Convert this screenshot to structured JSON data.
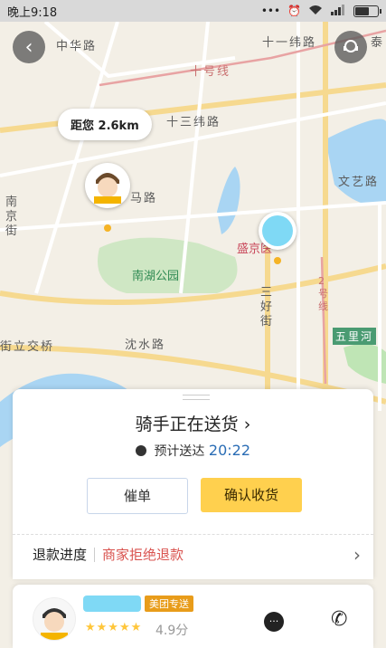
{
  "status_bar": {
    "time": "晚上9:18",
    "icons": [
      "dots",
      "alarm-icon",
      "wifi-icon",
      "signal-icon",
      "battery-icon"
    ]
  },
  "map": {
    "roads": [
      "中华路",
      "十一纬路",
      "十号线",
      "十三纬路",
      "马路",
      "南京街",
      "文艺路",
      "沈水路",
      "街立交桥",
      "三好街",
      "五里河",
      "2号线",
      "泰"
    ],
    "poi_park": "南湖公园",
    "poi_station": "盛京医",
    "distance_bubble": "距您 2.6km"
  },
  "card": {
    "title": "骑手正在送货 ",
    "title_chevron": "›",
    "eta_label": "预计送达",
    "eta_time": "20:22",
    "urge_button": "催单",
    "confirm_button": "确认收货",
    "refund_label": "退款进度",
    "refund_status": "商家拒绝退款",
    "refund_chevron": "›"
  },
  "rider": {
    "badge": "美团专送",
    "stars": "★★★★★",
    "score": "4.9分"
  },
  "colors": {
    "accent": "#ffd04e",
    "refund": "#d9534f",
    "eta": "#2a6db5"
  }
}
